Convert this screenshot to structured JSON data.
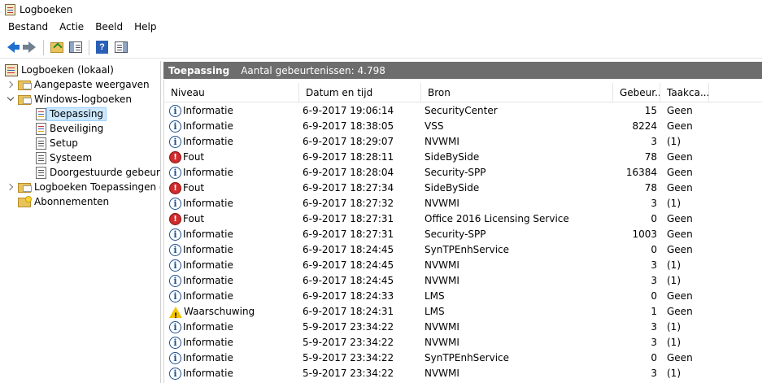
{
  "window": {
    "title": "Logboeken"
  },
  "menu": [
    "Bestand",
    "Actie",
    "Beeld",
    "Help"
  ],
  "toolbar": {
    "buttons": [
      "back-arrow-icon",
      "forward-arrow-icon",
      "up-folder-icon",
      "show-hide-tree-icon",
      "help-icon",
      "show-hide-action-pane-icon"
    ],
    "help_glyph": "?"
  },
  "tree": {
    "root": "Logboeken (lokaal)",
    "custom_views": "Aangepaste weergaven",
    "windows_logs": "Windows-logboeken",
    "application": "Toepassing",
    "security": "Beveiliging",
    "setup": "Setup",
    "system": "Systeem",
    "forwarded": "Doorgestuurde gebeurtenissen",
    "apps_services": "Logboeken Toepassingen en services",
    "subscriptions": "Abonnementen"
  },
  "pane": {
    "title": "Toepassing",
    "count_label": "Aantal gebeurtenissen: 4.798"
  },
  "columns": [
    "Niveau",
    "Datum en tijd",
    "Bron",
    "Gebeur...",
    "Taakca..."
  ],
  "events": [
    {
      "level": "Informatie",
      "type": "info",
      "date": "6-9-2017 19:06:14",
      "source": "SecurityCenter",
      "id": "15",
      "task": "Geen"
    },
    {
      "level": "Informatie",
      "type": "info",
      "date": "6-9-2017 18:38:05",
      "source": "VSS",
      "id": "8224",
      "task": "Geen"
    },
    {
      "level": "Informatie",
      "type": "info",
      "date": "6-9-2017 18:29:07",
      "source": "NVWMI",
      "id": "3",
      "task": "(1)"
    },
    {
      "level": "Fout",
      "type": "error",
      "date": "6-9-2017 18:28:11",
      "source": "SideBySide",
      "id": "78",
      "task": "Geen"
    },
    {
      "level": "Informatie",
      "type": "info",
      "date": "6-9-2017 18:28:04",
      "source": "Security-SPP",
      "id": "16384",
      "task": "Geen"
    },
    {
      "level": "Fout",
      "type": "error",
      "date": "6-9-2017 18:27:34",
      "source": "SideBySide",
      "id": "78",
      "task": "Geen"
    },
    {
      "level": "Informatie",
      "type": "info",
      "date": "6-9-2017 18:27:32",
      "source": "NVWMI",
      "id": "3",
      "task": "(1)"
    },
    {
      "level": "Fout",
      "type": "error",
      "date": "6-9-2017 18:27:31",
      "source": "Office 2016 Licensing Service",
      "id": "0",
      "task": "Geen"
    },
    {
      "level": "Informatie",
      "type": "info",
      "date": "6-9-2017 18:27:31",
      "source": "Security-SPP",
      "id": "1003",
      "task": "Geen"
    },
    {
      "level": "Informatie",
      "type": "info",
      "date": "6-9-2017 18:24:45",
      "source": "SynTPEnhService",
      "id": "0",
      "task": "Geen"
    },
    {
      "level": "Informatie",
      "type": "info",
      "date": "6-9-2017 18:24:45",
      "source": "NVWMI",
      "id": "3",
      "task": "(1)"
    },
    {
      "level": "Informatie",
      "type": "info",
      "date": "6-9-2017 18:24:45",
      "source": "NVWMI",
      "id": "3",
      "task": "(1)"
    },
    {
      "level": "Informatie",
      "type": "info",
      "date": "6-9-2017 18:24:33",
      "source": "LMS",
      "id": "0",
      "task": "Geen"
    },
    {
      "level": "Waarschuwing",
      "type": "warn",
      "date": "6-9-2017 18:24:31",
      "source": "LMS",
      "id": "1",
      "task": "Geen"
    },
    {
      "level": "Informatie",
      "type": "info",
      "date": "5-9-2017 23:34:22",
      "source": "NVWMI",
      "id": "3",
      "task": "(1)"
    },
    {
      "level": "Informatie",
      "type": "info",
      "date": "5-9-2017 23:34:22",
      "source": "NVWMI",
      "id": "3",
      "task": "(1)"
    },
    {
      "level": "Informatie",
      "type": "info",
      "date": "5-9-2017 23:34:22",
      "source": "SynTPEnhService",
      "id": "0",
      "task": "Geen"
    },
    {
      "level": "Informatie",
      "type": "info",
      "date": "5-9-2017 23:34:22",
      "source": "NVWMI",
      "id": "3",
      "task": "(1)"
    }
  ]
}
